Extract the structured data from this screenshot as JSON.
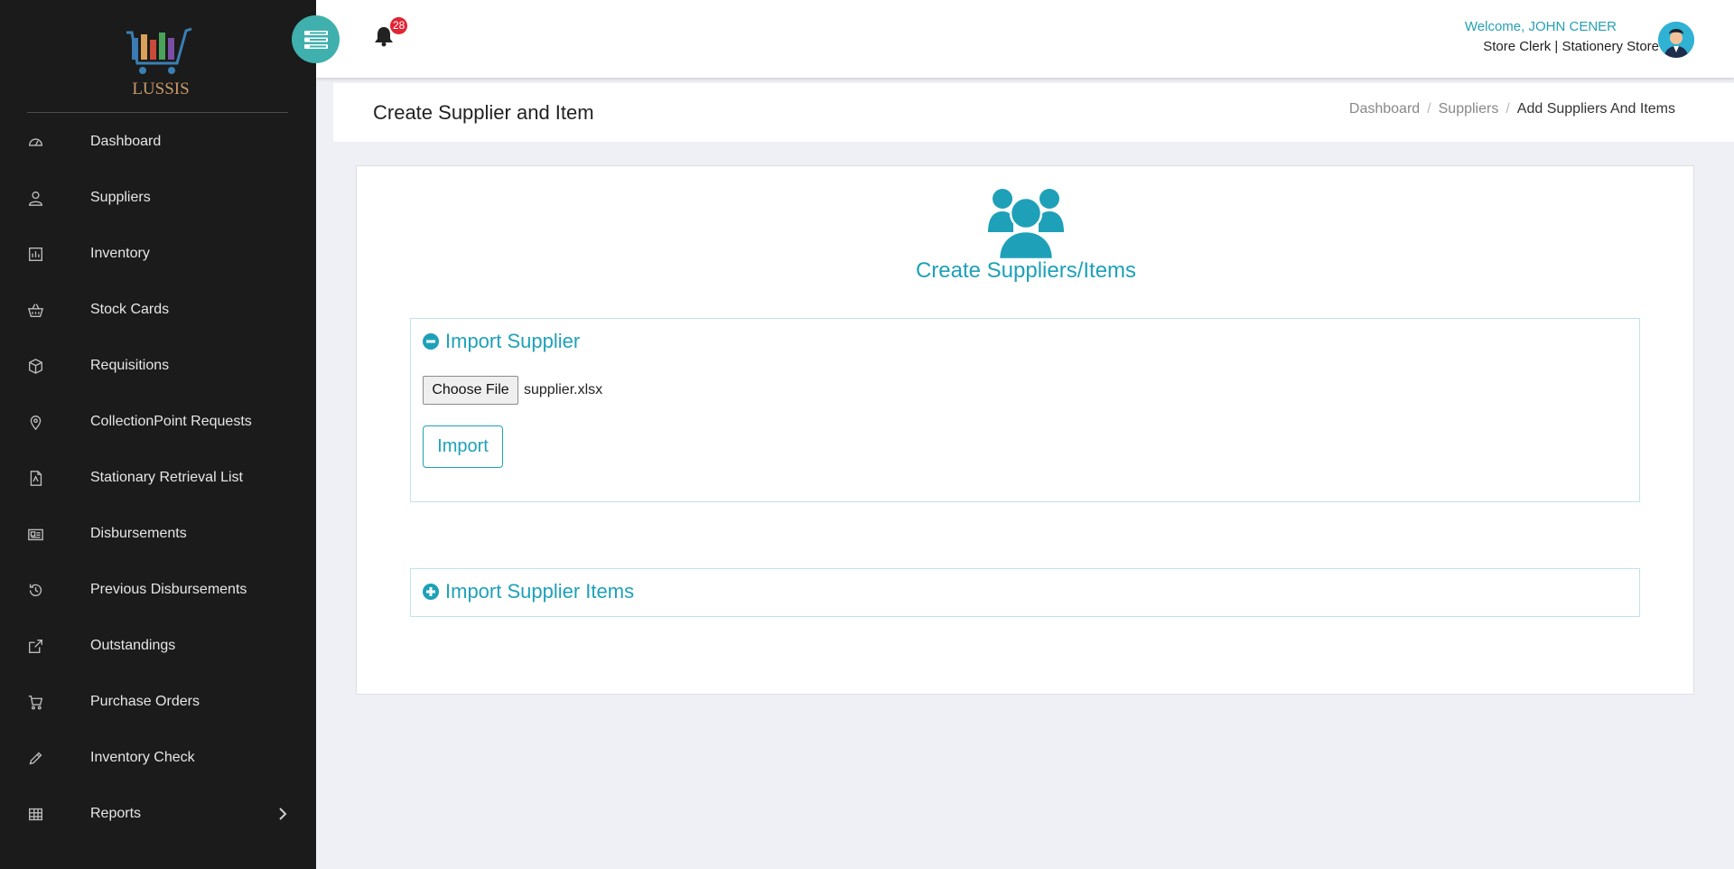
{
  "app": {
    "logo_text": "LUSSIS"
  },
  "sidebar": {
    "items": [
      {
        "label": "Dashboard",
        "icon": "dashboard-icon"
      },
      {
        "label": "Suppliers",
        "icon": "user-icon"
      },
      {
        "label": "Inventory",
        "icon": "chart-icon"
      },
      {
        "label": "Stock Cards",
        "icon": "basket-icon"
      },
      {
        "label": "Requisitions",
        "icon": "cube-icon"
      },
      {
        "label": "CollectionPoint Requests",
        "icon": "map-pin-icon"
      },
      {
        "label": "Stationary Retrieval List",
        "icon": "pdf-icon"
      },
      {
        "label": "Disbursements",
        "icon": "newspaper-icon"
      },
      {
        "label": "Previous Disbursements",
        "icon": "history-icon"
      },
      {
        "label": "Outstandings",
        "icon": "external-link-icon"
      },
      {
        "label": "Purchase Orders",
        "icon": "cart-icon"
      },
      {
        "label": "Inventory Check",
        "icon": "pencil-icon"
      },
      {
        "label": "Reports",
        "icon": "table-icon"
      }
    ]
  },
  "topbar": {
    "notification_count": "28",
    "welcome": "Welcome, JOHN CENER",
    "role": "Store Clerk | Stationery Store"
  },
  "page_header": {
    "title": "Create Supplier and Item",
    "breadcrumb": [
      "Dashboard",
      "Suppliers",
      "Add Suppliers And Items"
    ]
  },
  "card": {
    "title": "Create Suppliers/Items",
    "panel_supplier": {
      "title": "Import Supplier",
      "choose_file_label": "Choose File",
      "file_name": "supplier.xlsx",
      "import_label": "Import"
    },
    "panel_items": {
      "title": "Import Supplier Items"
    }
  },
  "colors": {
    "accent": "#1ea1b8",
    "sidebar_bg": "#1b1b1b",
    "toggle_bg": "#3fb0ad",
    "badge": "#e02535"
  }
}
